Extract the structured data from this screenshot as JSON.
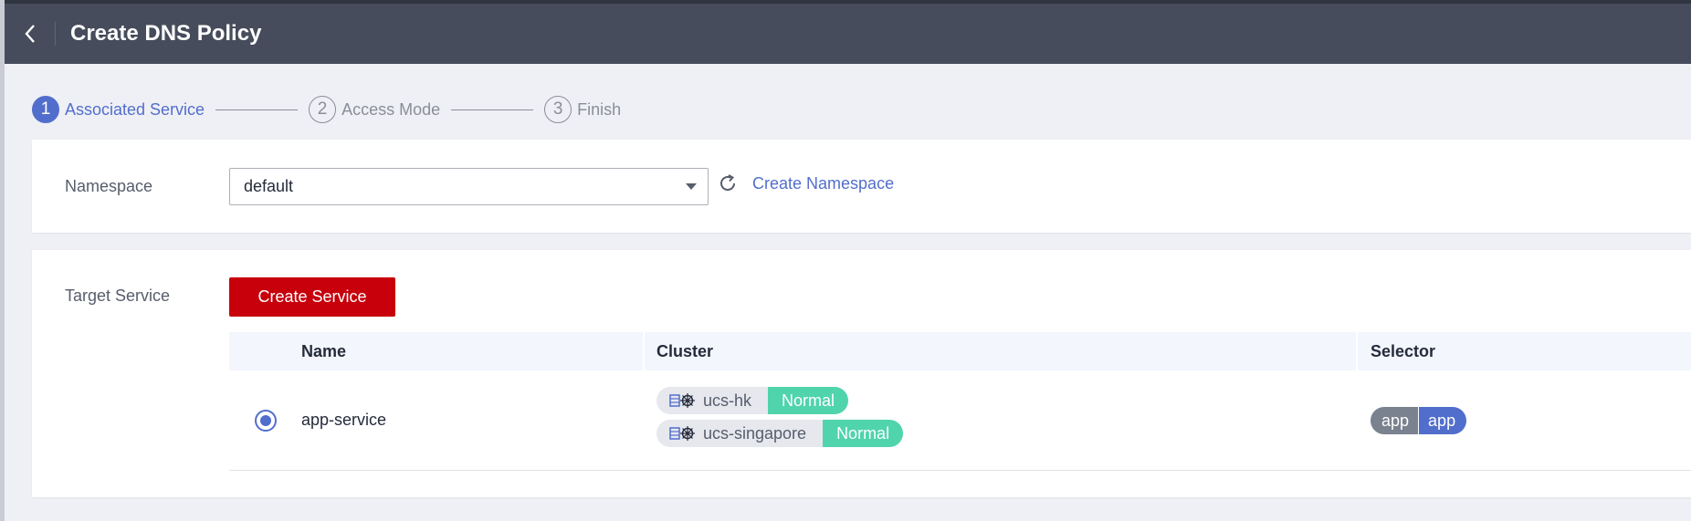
{
  "header": {
    "title": "Create DNS Policy"
  },
  "steps": [
    {
      "num": "1",
      "label": "Associated Service",
      "active": true
    },
    {
      "num": "2",
      "label": "Access Mode",
      "active": false
    },
    {
      "num": "3",
      "label": "Finish",
      "active": false
    }
  ],
  "namespace": {
    "label": "Namespace",
    "value": "default",
    "create_link": "Create Namespace"
  },
  "target": {
    "label": "Target Service",
    "create_button": "Create Service",
    "columns": [
      "Name",
      "Cluster",
      "Selector"
    ],
    "rows": [
      {
        "name": "app-service",
        "selected": true,
        "clusters": [
          {
            "name": "ucs-hk",
            "status": "Normal"
          },
          {
            "name": "ucs-singapore",
            "status": "Normal"
          }
        ],
        "selector": {
          "key": "app",
          "value": "app"
        }
      }
    ]
  },
  "colors": {
    "accent": "#526ecc",
    "primary_button": "#c7000b",
    "status_normal": "#50d4ab",
    "header_bg": "#464c5b"
  }
}
